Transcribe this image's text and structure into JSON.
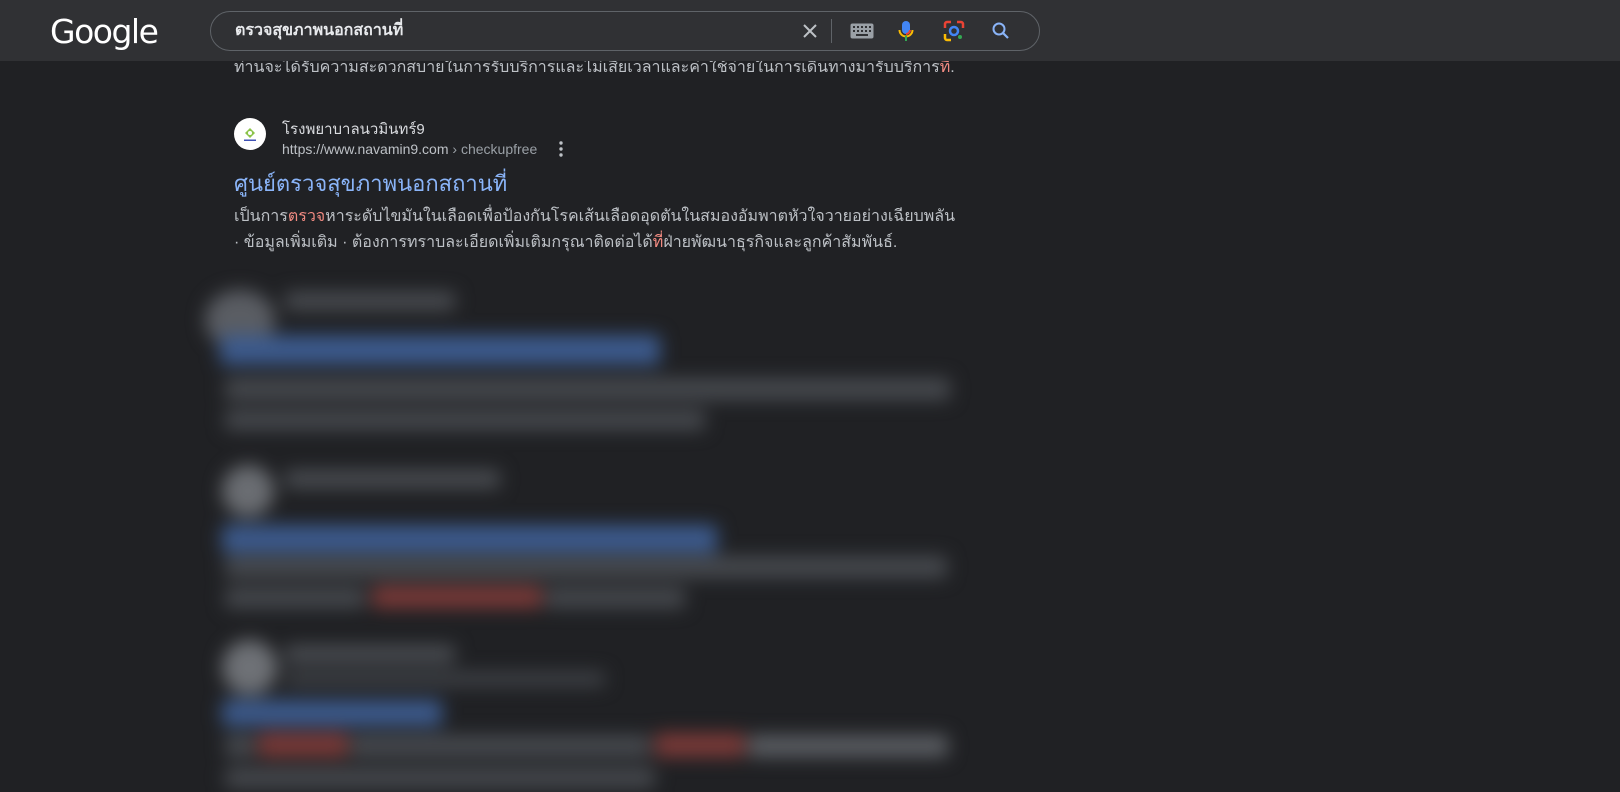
{
  "header": {
    "logo_text": "Google",
    "search": {
      "query": "ตรวจสุขภาพนอกสถานที่",
      "icons": [
        "close-icon",
        "keyboard-icon",
        "mic-icon",
        "lens-icon",
        "search-icon"
      ]
    }
  },
  "top_snippet": {
    "text": "ท่านจะได้รับความสะดวกสบายในการรับบริการและไม่เสียเวลาและค่าใช้จ่ายในการเดินทางมารับบริการ",
    "highlight": "ที่",
    "ellipsis": "..."
  },
  "result": {
    "site_name": "โรงพยาบาลนวมินทร์9",
    "url": "https://www.navamin9.com",
    "breadcrumb": " › checkupfree",
    "title": "ศูนย์ตรวจสุขภาพนอกสถานที่",
    "snippet_line1_before": "เป็นการ",
    "snippet_line1_highlight": "ตรวจ",
    "snippet_line1_after": "หาระดับไขมันในเลือดเพื่อป้องกันโรคเส้นเลือดอุดตันในสมองอัมพาตหัวใจวายอย่างเฉียบพลัน",
    "snippet_line2_before": "· ข้อมูลเพิ่มเติม · ต้องการทราบละเอียดเพิ่มเติมกรุณาติดต่อได้",
    "snippet_line2_highlight": "ที่",
    "snippet_line2_after": "ฝ่ายพัฒนาธุรกิจและลูกค้าสัมพันธ์."
  },
  "colors": {
    "background": "#202124",
    "header": "#303134",
    "link": "#8ab4f8",
    "highlight": "#f28b82",
    "text": "#bdc1c6"
  }
}
